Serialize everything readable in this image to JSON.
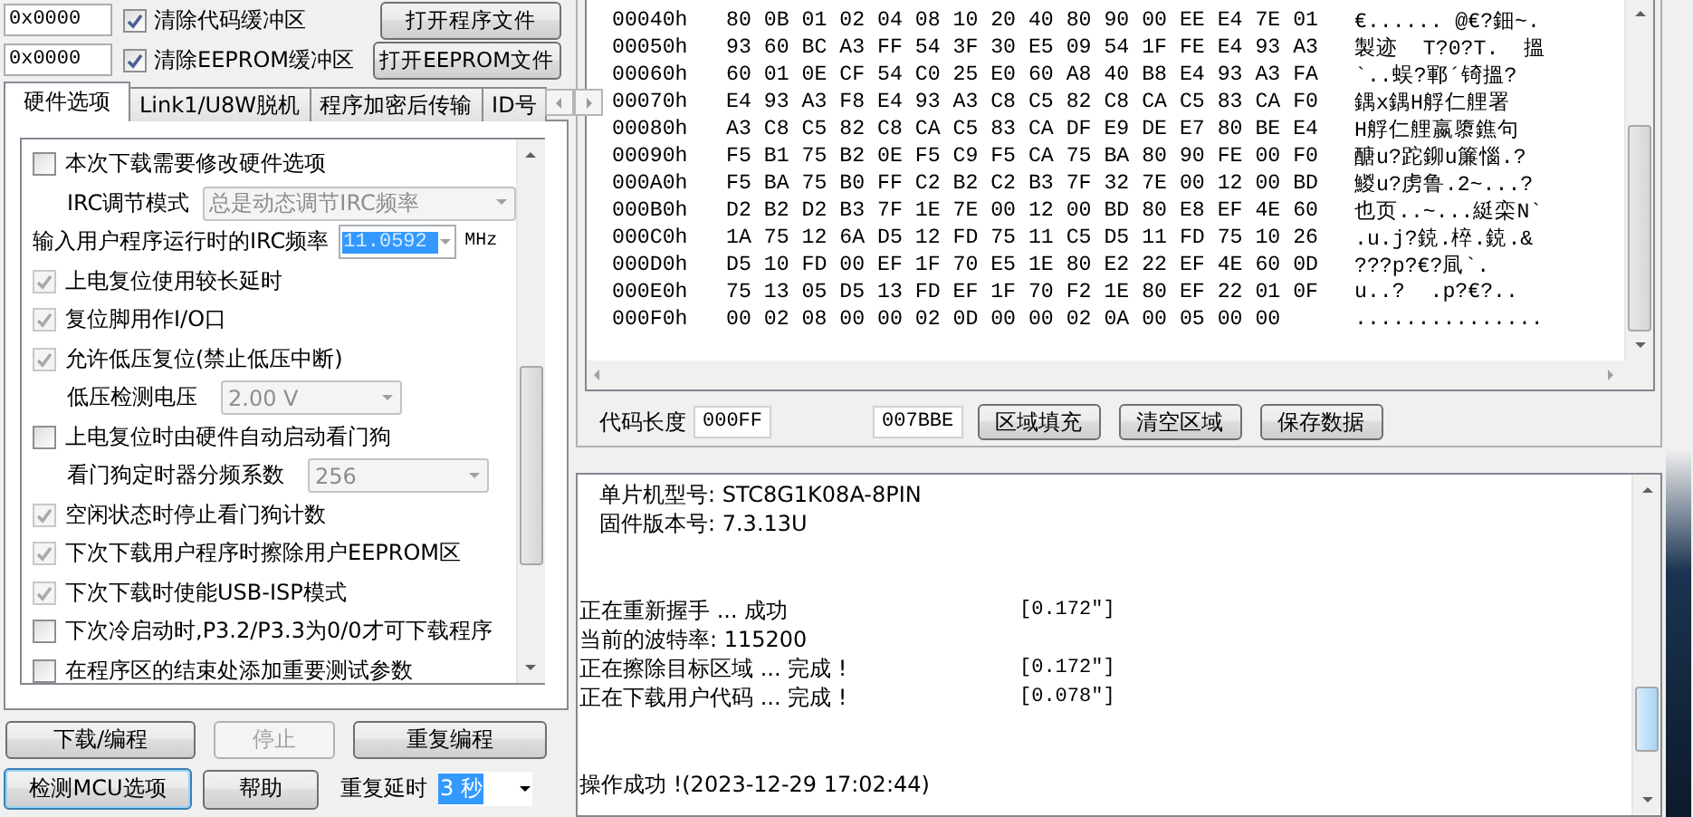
{
  "top_rows": [
    {
      "address": "0x0000",
      "checkbox": {
        "label": "清除代码缓冲区",
        "checked": true
      },
      "button": "打开程序文件"
    },
    {
      "address": "0x0000",
      "checkbox": {
        "label": "清除EEPROM缓冲区",
        "checked": true
      },
      "button": "打开EEPROM文件"
    }
  ],
  "tabs": [
    {
      "label": "硬件选项",
      "selected": true
    },
    {
      "label": "Link1/U8W脱机",
      "selected": false
    },
    {
      "label": "程序加密后传输",
      "selected": false
    },
    {
      "label": "ID号",
      "selected": false
    }
  ],
  "options": [
    {
      "kind": "checkbox",
      "label": "本次下载需要修改硬件选项",
      "checked": false,
      "disabled": false
    },
    {
      "kind": "select",
      "label": "IRC调节模式",
      "value": "总是动态调节IRC频率",
      "disabled": true
    },
    {
      "kind": "combo",
      "label": "输入用户程序运行时的IRC频率",
      "value": "11.0592",
      "unit": "MHz"
    },
    {
      "kind": "checkbox",
      "label": "上电复位使用较长延时",
      "checked": true,
      "disabled": true
    },
    {
      "kind": "checkbox",
      "label": "复位脚用作I/O口",
      "checked": true,
      "disabled": true
    },
    {
      "kind": "checkbox",
      "label": "允许低压复位(禁止低压中断)",
      "checked": true,
      "disabled": true
    },
    {
      "kind": "select",
      "label": "低压检测电压",
      "value": "2.00 V",
      "disabled": true
    },
    {
      "kind": "checkbox",
      "label": "上电复位时由硬件自动启动看门狗",
      "checked": false,
      "disabled": false
    },
    {
      "kind": "select",
      "label": "看门狗定时器分频系数",
      "value": "256",
      "disabled": true
    },
    {
      "kind": "checkbox",
      "label": "空闲状态时停止看门狗计数",
      "checked": true,
      "disabled": true
    },
    {
      "kind": "checkbox",
      "label": "下次下载用户程序时擦除用户EEPROM区",
      "checked": true,
      "disabled": true
    },
    {
      "kind": "checkbox",
      "label": "下次下载时使能USB-ISP模式",
      "checked": true,
      "disabled": true
    },
    {
      "kind": "checkbox",
      "label": "下次冷启动时,P3.2/P3.3为0/0才可下载程序",
      "checked": false,
      "disabled": false
    },
    {
      "kind": "checkbox",
      "label": "在程序区的结束处添加重要测试参数",
      "checked": false,
      "disabled": false
    }
  ],
  "actions": [
    {
      "label": "下载/编程",
      "disabled": false
    },
    {
      "label": "停止",
      "disabled": true
    },
    {
      "label": "重复编程",
      "disabled": false
    }
  ],
  "bottom": {
    "button": "检测MCU选项",
    "help": "帮助",
    "delay_label": "重复延时",
    "delay_value": "3 秒"
  },
  "hex": {
    "rows": [
      {
        "address": "00040h",
        "bytes": "80 0B 01 02 04 08 10 20 40 80 90 00 EE E4 7E 01",
        "text": "€...... @€?鈿~."
      },
      {
        "address": "00050h",
        "bytes": "93 60 BC A3 FF 54 3F 30 E5 09 54 1F FE E4 93 A3",
        "text": "製迹  T?0?T.  搵"
      },
      {
        "address": "00060h",
        "bytes": "60 01 0E CF 54 C0 25 E0 60 A8 40 B8 E4 93 A3 FA",
        "text": "`..蜈?鄆´锜搵?"
      },
      {
        "address": "00070h",
        "bytes": "E4 93 A3 F8 E4 93 A3 C8 C5 82 C8 CA C5 83 CA F0",
        "text": "鍝x鍝H艀仁艃署"
      },
      {
        "address": "00080h",
        "bytes": "A3 C8 C5 82 C8 CA C5 83 CA DF E9 DE E7 80 BE E4",
        "text": "H艀仁艃嬴隳鐎句"
      },
      {
        "address": "00090h",
        "bytes": "F5 B1 75 B2 0E F5 C9 F5 CA 75 BA 80 90 FE 00 F0",
        "text": "醣u?跎鉚u簾惱.?"
      },
      {
        "address": "000A0h",
        "bytes": "F5 BA 75 B0 FF C2 B2 C2 B3 7F 32 7E 00 12 00 BD",
        "text": "鯼u?虏鲁.2~...?"
      },
      {
        "address": "000B0h",
        "bytes": "D2 B2 D2 B3 7F 1E 7E 00 12 00 BD 80 E8 EF 4E 60",
        "text": "也页..~...綎栾N`"
      },
      {
        "address": "000C0h",
        "bytes": "1A 75 12 6A D5 12 FD 75 11 C5 D5 11 FD 75 10 26",
        "text": ".u.j?鋴.椊.鋴.&"
      },
      {
        "address": "000D0h",
        "bytes": "D5 10 FD 00 EF 1F 70 E5 1E 80 E2 22 EF 4E 60 0D",
        "text": "???p?€?凬`."
      },
      {
        "address": "000E0h",
        "bytes": "75 13 05 D5 13 FD EF 1F 70 F2 1E 80 EF 22 01 0F",
        "text": "u..?  .p?€?.."
      },
      {
        "address": "000F0h",
        "bytes": "00 02 08 00 00 02 0D 00 00 02 0A 00 05 00 00",
        "text": "..............."
      }
    ],
    "length_label": "代码长度",
    "length_value": "000FF",
    "checksum": "007BBE",
    "buttons": [
      "区域填充",
      "清空区域",
      "保存数据"
    ]
  },
  "log": [
    {
      "kind": "info",
      "text": "单片机型号: STC8G1K08A-8PIN"
    },
    {
      "kind": "info",
      "text": "固件版本号: 7.3.13U"
    },
    {
      "kind": "blank"
    },
    {
      "kind": "blank"
    },
    {
      "kind": "step",
      "text": "正在重新握手 ... 成功",
      "time": "[0.172\"]"
    },
    {
      "kind": "step",
      "text": "当前的波特率: 115200"
    },
    {
      "kind": "step",
      "text": "正在擦除目标区域 ... 完成 !",
      "time": "[0.172\"]"
    },
    {
      "kind": "step",
      "text": "正在下载用户代码 ... 完成 !",
      "time": "[0.078\"]"
    },
    {
      "kind": "blank"
    },
    {
      "kind": "blank"
    },
    {
      "kind": "step",
      "text": "操作成功 !(2023-12-29 17:02:44)"
    }
  ]
}
